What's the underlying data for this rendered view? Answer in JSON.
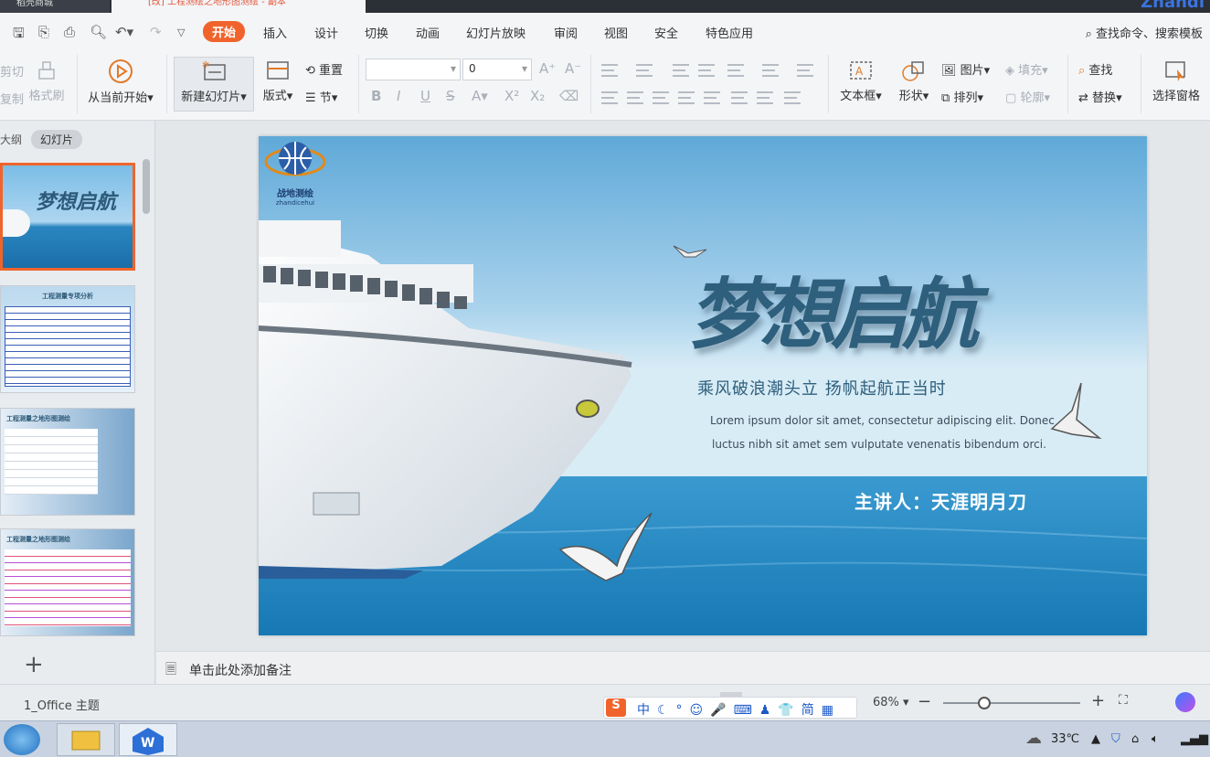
{
  "titlebar": {
    "tab1": "稻壳商城",
    "tab2": "[改] 工程测绘之地形图测绘 - 副本",
    "brand": "Zhandi"
  },
  "menu": {
    "items": [
      "开始",
      "插入",
      "设计",
      "切换",
      "动画",
      "幻灯片放映",
      "审阅",
      "视图",
      "安全",
      "特色应用"
    ],
    "active": "开始",
    "search": "查找命令、搜索模板"
  },
  "ribbon": {
    "cut": "剪切",
    "copy": "复制",
    "format_painter": "格式刷",
    "from_current": "从当前开始",
    "new_slide": "新建幻灯片",
    "layout": "版式",
    "reset": "重置",
    "section": "节",
    "font_name": "",
    "font_size": "0",
    "text_box": "文本框",
    "shape": "形状",
    "picture": "图片",
    "fill": "填充",
    "arrange": "排列",
    "outline": "轮廓",
    "find": "查找",
    "replace": "替换",
    "select_pane": "选择窗格"
  },
  "left_panel": {
    "tab_outline": "大纲",
    "tab_slides": "幻灯片",
    "thumb2_title": "工程测量专项分析",
    "thumb3_title": "工程测量之地形图测绘",
    "thumb4_title": "工程测量之地形图测绘"
  },
  "slide": {
    "logo_text": "战地测绘",
    "logo_sub": "zhandicehui",
    "title": "梦想启航",
    "subtitle": "乘风破浪潮头立  扬帆起航正当时",
    "lorem_line1": "Lorem ipsum dolor sit amet, consectetur adipiscing elit. Donec",
    "lorem_line2": "luctus nibh sit amet sem vulputate venenatis bibendum orci.",
    "presenter": "主讲人：天涯明月刀"
  },
  "notes": {
    "placeholder": "单击此处添加备注"
  },
  "status": {
    "theme": "1_Office 主题",
    "zoom": "68%",
    "zoom_fraction": 0.3
  },
  "taskbar": {
    "temperature": "33℃"
  },
  "colors": {
    "accent": "#f0642c",
    "sea": "#2f8fc4",
    "sky": "#7fbfe2"
  }
}
